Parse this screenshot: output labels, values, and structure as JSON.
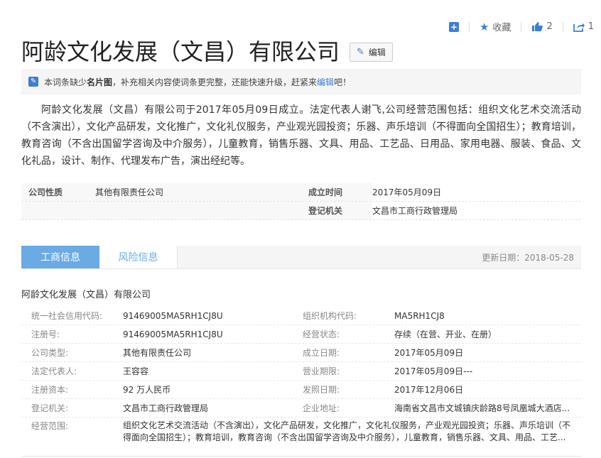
{
  "toolbar": {
    "favorite_label": "收藏",
    "like_count": "2",
    "share_count": "1"
  },
  "title": "阿龄文化发展（文昌）有限公司",
  "edit_label": "编辑",
  "notice": {
    "prefix": "本词条缺少",
    "bold": "名片图",
    "middle": "，补充相关内容使词条更完整，还能快速升级，赶紧来",
    "link": "编辑",
    "suffix": "吧！"
  },
  "summary": "阿龄文化发展（文昌）有限公司于2017年05月09日成立。法定代表人谢飞,公司经营范围包括：组织文化艺术交流活动（不含演出），文化产品研发，文化推广，文化礼仪服务，产业观光园投资；乐器、声乐培训（不得面向全国招生）；教育培训，教育咨询（不含出国留学咨询及中介服务），儿童教育，销售乐器、文具、用品、工艺品、日用品、家用电器、服装、食品、文化礼品，设计、制作、代理发布广告，演出经纪等。",
  "basic": {
    "type_label": "公司性质",
    "type_value": "其他有限责任公司",
    "founded_label": "成立时间",
    "founded_value": "2017年05月09日",
    "authority_label": "登记机关",
    "authority_value": "文昌市工商行政管理局"
  },
  "tabs": {
    "business": "工商信息",
    "risk": "风险信息",
    "updated": "更新日期：2018-05-28"
  },
  "company_name": "阿龄文化发展（文昌）有限公司",
  "details": {
    "credit_code_label": "统一社会信用代码:",
    "credit_code": "91469005MA5RH1CJ8U",
    "org_code_label": "组织机构代码:",
    "org_code": "MA5RH1CJ8",
    "reg_no_label": "注册号:",
    "reg_no": "91469005MA5RH1CJ8U",
    "status_label": "经营状态:",
    "status": "存续（在营、开业、在册）",
    "company_type_label": "公司类型:",
    "company_type": "其他有限责任公司",
    "founded_label": "成立日期:",
    "founded": "2017年05月09日",
    "legal_rep_label": "法定代表人:",
    "legal_rep": "王容容",
    "term_label": "营业期限:",
    "term": "2017年05月09日---",
    "capital_label": "注册资本:",
    "capital": "92 万人民币",
    "issue_label": "发照日期:",
    "issue": "2017年12月06日",
    "authority_label": "登记机关:",
    "authority": "文昌市工商行政管理局",
    "address_label": "企业地址:",
    "address": "海南省文昌市文城镇庆龄路8号凤凰城大酒店...",
    "scope_label": "经营范围:",
    "scope": "组织文化艺术交流活动（不含演出），文化产品研发，文化推广，文化礼仪服务，产业观光园投资；乐器、声乐培训（不得面向全国招生）；教育培训，教育咨询（不含出国留学咨询及中介服务），儿童教育，销售乐器、文具、用品、工艺..."
  }
}
